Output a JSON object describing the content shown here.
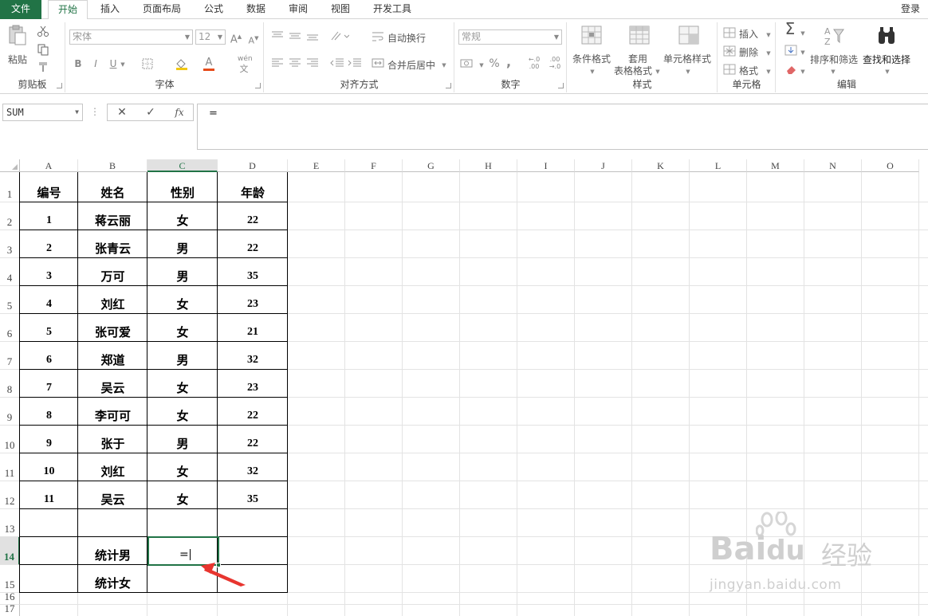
{
  "tabs": [
    {
      "label": "文件",
      "kind": "file"
    },
    {
      "label": "开始",
      "kind": "active"
    },
    {
      "label": "插入",
      "kind": ""
    },
    {
      "label": "页面布局",
      "kind": ""
    },
    {
      "label": "公式",
      "kind": ""
    },
    {
      "label": "数据",
      "kind": ""
    },
    {
      "label": "审阅",
      "kind": ""
    },
    {
      "label": "视图",
      "kind": ""
    },
    {
      "label": "开发工具",
      "kind": ""
    }
  ],
  "login_label": "登录",
  "ribbon": {
    "clipboard": {
      "group_label": "剪贴板",
      "paste_label": "粘贴"
    },
    "font": {
      "group_label": "字体",
      "font_name": "宋体",
      "font_size": "12",
      "bold": "B",
      "italic": "I",
      "underline": "U",
      "wen": "wén",
      "wen2": "文"
    },
    "alignment": {
      "group_label": "对齐方式",
      "wrap_label": "自动换行",
      "merge_label": "合并后居中"
    },
    "number": {
      "group_label": "数字",
      "format": "常规",
      "percent": "%",
      "comma": ",",
      "dec_inc": "←.0 .00",
      "dec_dec": ".00 →.0"
    },
    "styles": {
      "group_label": "样式",
      "conditional": "条件格式",
      "table_1": "套用",
      "table_2": "表格格式",
      "cell_styles": "单元格样式"
    },
    "cells": {
      "group_label": "单元格",
      "insert": "插入",
      "delete": "删除",
      "format": "格式"
    },
    "editing": {
      "group_label": "编辑",
      "sort_filter": "排序和筛选",
      "find_select": "查找和选择"
    }
  },
  "formula_bar": {
    "name_box": "SUM",
    "dots": "⋮",
    "cancel": "✕",
    "enter": "✓",
    "fx": "fx",
    "content": "="
  },
  "sheet": {
    "columns": [
      "A",
      "B",
      "C",
      "D",
      "E",
      "F",
      "G",
      "H",
      "I",
      "J",
      "K",
      "L",
      "M",
      "N",
      "O"
    ],
    "rows": [
      "1",
      "2",
      "3",
      "4",
      "5",
      "6",
      "7",
      "8",
      "9",
      "10",
      "11",
      "12",
      "13",
      "14",
      "15",
      "16",
      "17"
    ],
    "selected_column": "C",
    "selected_row": "14",
    "headers": [
      "编号",
      "姓名",
      "性别",
      "年龄"
    ],
    "records": [
      [
        "1",
        "蒋云丽",
        "女",
        "22"
      ],
      [
        "2",
        "张青云",
        "男",
        "22"
      ],
      [
        "3",
        "万可",
        "男",
        "35"
      ],
      [
        "4",
        "刘红",
        "女",
        "23"
      ],
      [
        "5",
        "张可爱",
        "女",
        "21"
      ],
      [
        "6",
        "郑道",
        "男",
        "32"
      ],
      [
        "7",
        "吴云",
        "女",
        "23"
      ],
      [
        "8",
        "李可可",
        "女",
        "22"
      ],
      [
        "9",
        "张于",
        "男",
        "22"
      ],
      [
        "10",
        "刘红",
        "女",
        "32"
      ],
      [
        "11",
        "吴云",
        "女",
        "35"
      ]
    ],
    "stat_male_label": "统计男",
    "stat_female_label": "统计女",
    "active_cell_text": "="
  },
  "watermark": {
    "brand": "Bai",
    "brand2": "du",
    "product": "经验",
    "url": "jingyan.baidu.com"
  },
  "colors": {
    "accent": "#217346",
    "arrow": "#e8352f"
  }
}
